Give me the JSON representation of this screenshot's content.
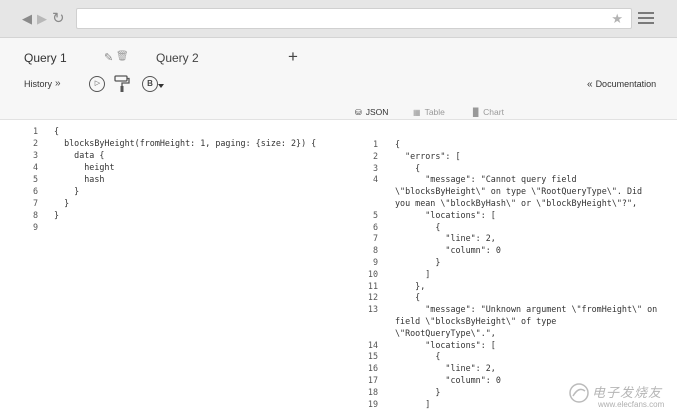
{
  "browser": {
    "back_icon": "arrow-left-icon",
    "forward_icon": "arrow-right-icon",
    "reload_icon": "reload-icon",
    "bookmark_icon": "star-icon",
    "menu_icon": "hamburger-menu-icon"
  },
  "tabs": [
    {
      "label": "Query 1",
      "active": true
    },
    {
      "label": "Query 2",
      "active": false
    }
  ],
  "toolbar": {
    "history_label": "History",
    "history_chevron": "»",
    "run_icon": "play-icon",
    "prettify_icon": "paint-roller-icon",
    "b_label": "B",
    "documentation_chevron": "«",
    "documentation_label": "Documentation"
  },
  "views": {
    "json": "JSON",
    "table": "Table",
    "chart": "Chart"
  },
  "query_lines": [
    {
      "n": "1",
      "text": "{"
    },
    {
      "n": "2",
      "text": "  blocksByHeight(fromHeight: 1, paging: {size: 2}) {"
    },
    {
      "n": "3",
      "text": "    data {"
    },
    {
      "n": "4",
      "text": "      height"
    },
    {
      "n": "5",
      "text": "      hash"
    },
    {
      "n": "6",
      "text": "    }"
    },
    {
      "n": "7",
      "text": "  }"
    },
    {
      "n": "8",
      "text": "}"
    },
    {
      "n": "9",
      "text": ""
    }
  ],
  "result_lines": [
    {
      "n": "1",
      "text": "{"
    },
    {
      "n": "2",
      "text": "  \"errors\": ["
    },
    {
      "n": "3",
      "text": "    {"
    },
    {
      "n": "4",
      "text": "      \"message\": \"Cannot query field"
    },
    {
      "n": "",
      "text": "\\\"blocksByHeight\\\" on type \\\"RootQueryType\\\". Did"
    },
    {
      "n": "",
      "text": "you mean \\\"blockByHash\\\" or \\\"blockByHeight\\\"?\","
    },
    {
      "n": "5",
      "text": "      \"locations\": ["
    },
    {
      "n": "6",
      "text": "        {"
    },
    {
      "n": "7",
      "text": "          \"line\": 2,"
    },
    {
      "n": "8",
      "text": "          \"column\": 0"
    },
    {
      "n": "9",
      "text": "        }"
    },
    {
      "n": "10",
      "text": "      ]"
    },
    {
      "n": "11",
      "text": "    },"
    },
    {
      "n": "12",
      "text": "    {"
    },
    {
      "n": "13",
      "text": "      \"message\": \"Unknown argument \\\"fromHeight\\\" on"
    },
    {
      "n": "",
      "text": "field \\\"blocksByHeight\\\" of type"
    },
    {
      "n": "",
      "text": "\\\"RootQueryType\\\".\","
    },
    {
      "n": "14",
      "text": "      \"locations\": ["
    },
    {
      "n": "15",
      "text": "        {"
    },
    {
      "n": "16",
      "text": "          \"line\": 2,"
    },
    {
      "n": "17",
      "text": "          \"column\": 0"
    },
    {
      "n": "18",
      "text": "        }"
    },
    {
      "n": "19",
      "text": "      ]"
    }
  ],
  "watermark": {
    "logo": "elecfans-logo",
    "text": "电子发烧友",
    "url": "www.elecfans.com"
  }
}
